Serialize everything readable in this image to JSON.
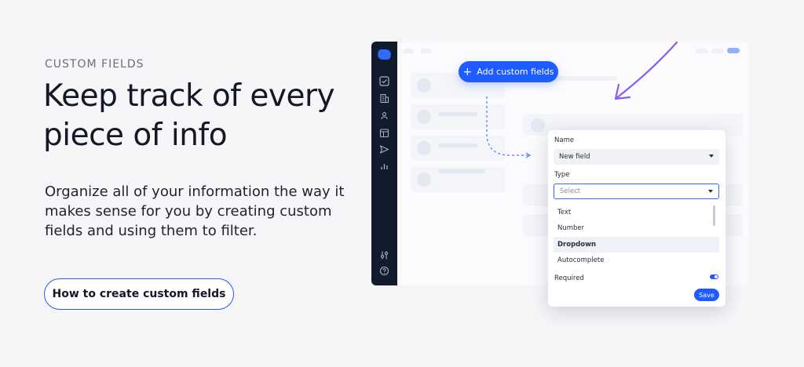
{
  "hero": {
    "eyebrow": "CUSTOM FIELDS",
    "headline": "Keep track of every piece of info",
    "body": "Organize all of your information the way it makes sense for you by creating custom fields and using them to filter.",
    "cta_label": "How to create custom fields"
  },
  "mockup": {
    "add_button_label": "Add custom fields",
    "add_button_icon": "plus-icon",
    "sidebar_icons": [
      "checkbox-icon",
      "building-icon",
      "user-icon",
      "calendar-icon",
      "send-icon",
      "chart-icon",
      "sliders-icon",
      "help-icon"
    ],
    "accent_color": "#1f5cff",
    "arrow_color": "#8b5cf6",
    "modal": {
      "name_label": "Name",
      "name_value": "New field",
      "type_label": "Type",
      "type_placeholder": "Select",
      "options": [
        "Text",
        "Number",
        "Dropdown",
        "Autocomplete"
      ],
      "highlighted_option": "Dropdown",
      "required_label": "Required",
      "required_on": true,
      "save_label": "Save"
    }
  }
}
